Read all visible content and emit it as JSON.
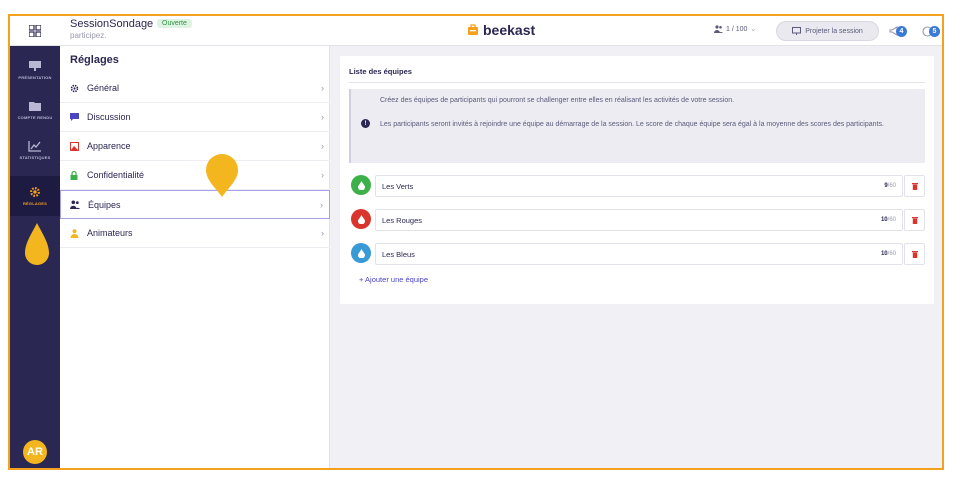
{
  "app": {
    "session_name": "SessionSondage",
    "session_status": "Ouverte",
    "session_code": "participez.",
    "brand": "beekast",
    "participants_count": "1 / 100",
    "project_label": "Projeter la session",
    "notifications_count": "4",
    "help_count": "5"
  },
  "sidebar": {
    "items": [
      {
        "label": "PRÉSENTATION",
        "icon": "presentation-icon"
      },
      {
        "label": "COMPTE RENDU",
        "icon": "folder-icon"
      },
      {
        "label": "STATISTIQUES",
        "icon": "chart-icon"
      },
      {
        "label": "RÉGLAGES",
        "icon": "gear-icon",
        "active": true
      }
    ],
    "avatar_initials": "AR"
  },
  "settings": {
    "title": "Réglages",
    "items": [
      {
        "label": "Général",
        "icon": "gear-icon"
      },
      {
        "label": "Discussion",
        "icon": "chat-icon"
      },
      {
        "label": "Apparence",
        "icon": "image-icon"
      },
      {
        "label": "Confidentialité",
        "icon": "lock-icon"
      },
      {
        "label": "Équipes",
        "icon": "users-icon",
        "active": true
      },
      {
        "label": "Animateurs",
        "icon": "person-icon"
      }
    ]
  },
  "teams_panel": {
    "title": "Liste des équipes",
    "info_line1": "Créez des équipes de participants qui pourront se challenger entre elles en réalisant les activités de votre session.",
    "info_line2": "Les participants seront invités à rejoindre une équipe au démarrage de la session. Le score de chaque équipe sera égal à la moyenne des scores des participants.",
    "teams": [
      {
        "name": "Les Verts",
        "score": "9",
        "max": "/60",
        "color": "#3db04a"
      },
      {
        "name": "Les Rouges",
        "score": "10",
        "max": "/60",
        "color": "#d9352c"
      },
      {
        "name": "Les Bleus",
        "score": "10",
        "max": "/60",
        "color": "#3a9ad6"
      }
    ],
    "add_label": "+ Ajouter une équipe"
  },
  "colors": {
    "accent": "#f4a21e",
    "rail": "#2a2752",
    "link": "#4b45c4",
    "delete": "#d9352c"
  }
}
